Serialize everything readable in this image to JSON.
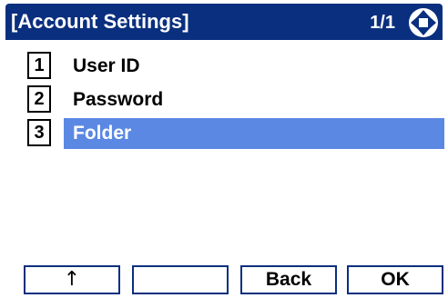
{
  "header": {
    "title": "[Account Settings]",
    "page_indicator": "1/1"
  },
  "menu": {
    "items": [
      {
        "number": "1",
        "label": "User ID",
        "selected": false
      },
      {
        "number": "2",
        "label": "Password",
        "selected": false
      },
      {
        "number": "3",
        "label": "Folder",
        "selected": true
      }
    ]
  },
  "softkeys": {
    "key1": "↑",
    "key2": "",
    "key3": "Back",
    "key4": "OK"
  },
  "colors": {
    "header_background": "#0a2f7e",
    "selection_highlight": "#5b88e3",
    "softkey_border": "#0a2f7e"
  },
  "icons": {
    "navigation": "up-down-left-right-nav-icon"
  }
}
